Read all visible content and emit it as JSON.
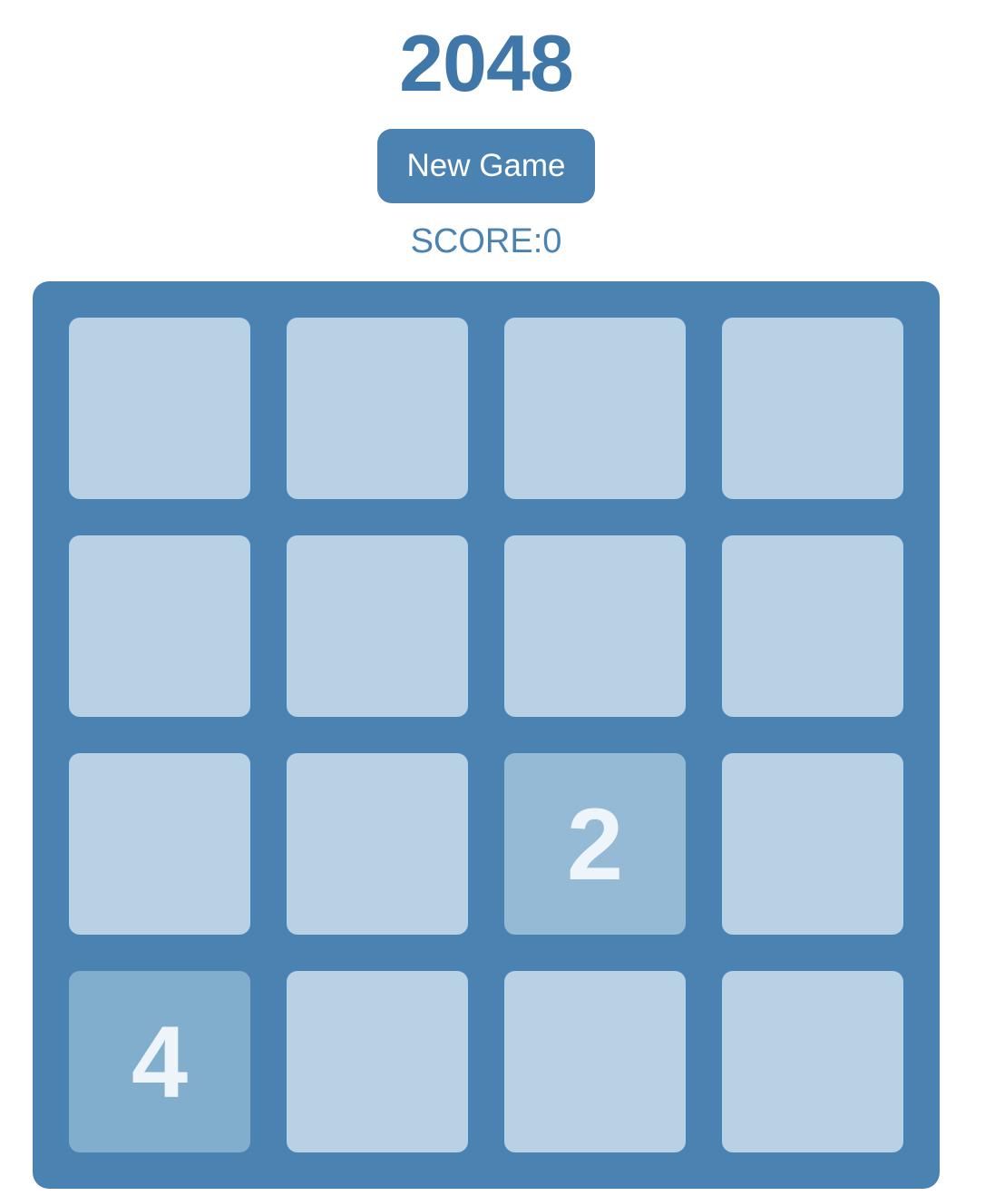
{
  "game": {
    "title": "2048",
    "new_game_label": "New Game",
    "score_text": "SCORE:0",
    "score": 0
  },
  "colors": {
    "accent": "#4a82b1",
    "title": "#3f77a8",
    "empty_cell": "#b8d2e4",
    "tile_2": "#95bad5",
    "tile_4": "#81aecd",
    "tile_text": "#eef5fa"
  },
  "board": {
    "rows": [
      [
        "",
        "",
        "",
        ""
      ],
      [
        "",
        "",
        "",
        ""
      ],
      [
        "",
        "",
        "2",
        ""
      ],
      [
        "4",
        "",
        "",
        ""
      ]
    ]
  }
}
